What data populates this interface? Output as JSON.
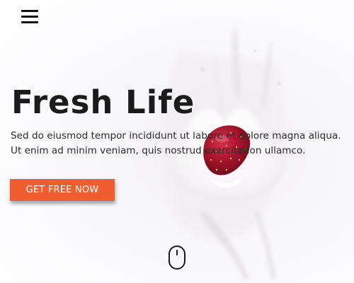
{
  "header": {
    "menu_icon": "hamburger-menu-icon"
  },
  "hero": {
    "title": "Fresh Life",
    "description": "Sed do eiusmod tempor incididunt ut labore et dolore magna aliqua. Ut enim ad minim veniam, quis nostrud exercitation ullamco.",
    "cta_label": "GET FREE NOW",
    "background_image": "strawberry-milk-splash",
    "scroll_icon": "mouse-scroll-icon"
  },
  "colors": {
    "accent": "#f05e2f",
    "title": "#1b1b1b",
    "text": "#2b2b2b",
    "background": "#fbfbfd"
  }
}
